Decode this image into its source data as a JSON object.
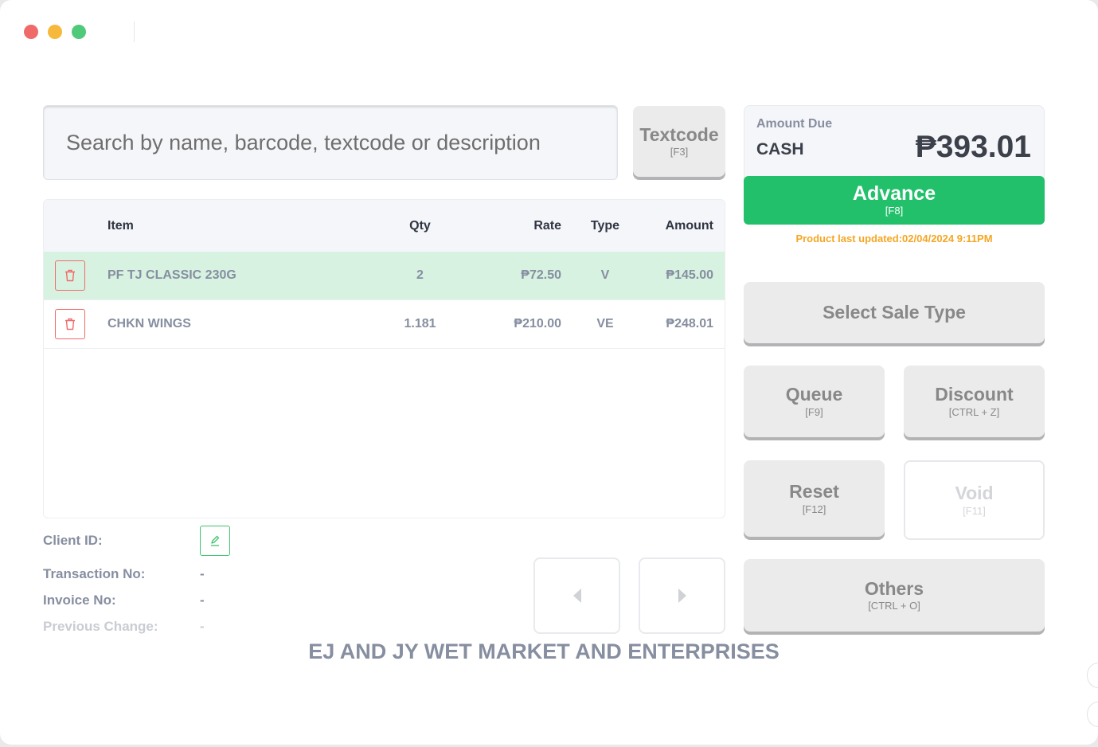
{
  "window": {
    "traffic_lights": [
      "close",
      "minimize",
      "maximize"
    ]
  },
  "search": {
    "placeholder": "Search by name, barcode, textcode or description",
    "value": ""
  },
  "textcode_button": {
    "label": "Textcode",
    "shortcut": "[F3]"
  },
  "table": {
    "headers": {
      "item": "Item",
      "qty": "Qty",
      "rate": "Rate",
      "type": "Type",
      "amount": "Amount"
    },
    "rows": [
      {
        "item": "PF TJ CLASSIC 230G",
        "qty": "2",
        "rate": "₱72.50",
        "type": "V",
        "amount": "₱145.00",
        "selected": true
      },
      {
        "item": "CHKN WINGS",
        "qty": "1.181",
        "rate": "₱210.00",
        "type": "VE",
        "amount": "₱248.01",
        "selected": false
      }
    ]
  },
  "info": {
    "client_id_label": "Client ID:",
    "transaction_label": "Transaction No:",
    "transaction_value": "-",
    "invoice_label": "Invoice No:",
    "invoice_value": "-",
    "prev_change_label": "Previous Change:",
    "prev_change_value": "-"
  },
  "company_name": "EJ AND JY WET MARKET AND ENTERPRISES",
  "amount_due": {
    "label": "Amount Due",
    "payment_type": "CASH",
    "value": "₱393.01"
  },
  "advance_button": {
    "label": "Advance",
    "shortcut": "[F8]"
  },
  "product_updated": "Product last updated:02/04/2024 9:11PM",
  "buttons": {
    "sale_type": {
      "label": "Select Sale Type"
    },
    "queue": {
      "label": "Queue",
      "shortcut": "[F9]"
    },
    "discount": {
      "label": "Discount",
      "shortcut": "[CTRL + Z]"
    },
    "reset": {
      "label": "Reset",
      "shortcut": "[F12]"
    },
    "void": {
      "label": "Void",
      "shortcut": "[F11]",
      "disabled": true
    },
    "others": {
      "label": "Others",
      "shortcut": "[CTRL + O]"
    }
  },
  "colors": {
    "accent_green": "#22c06b",
    "selected_row": "#d8f2e1",
    "delete_red": "#f06a6a",
    "updated_orange": "#f5a623"
  }
}
